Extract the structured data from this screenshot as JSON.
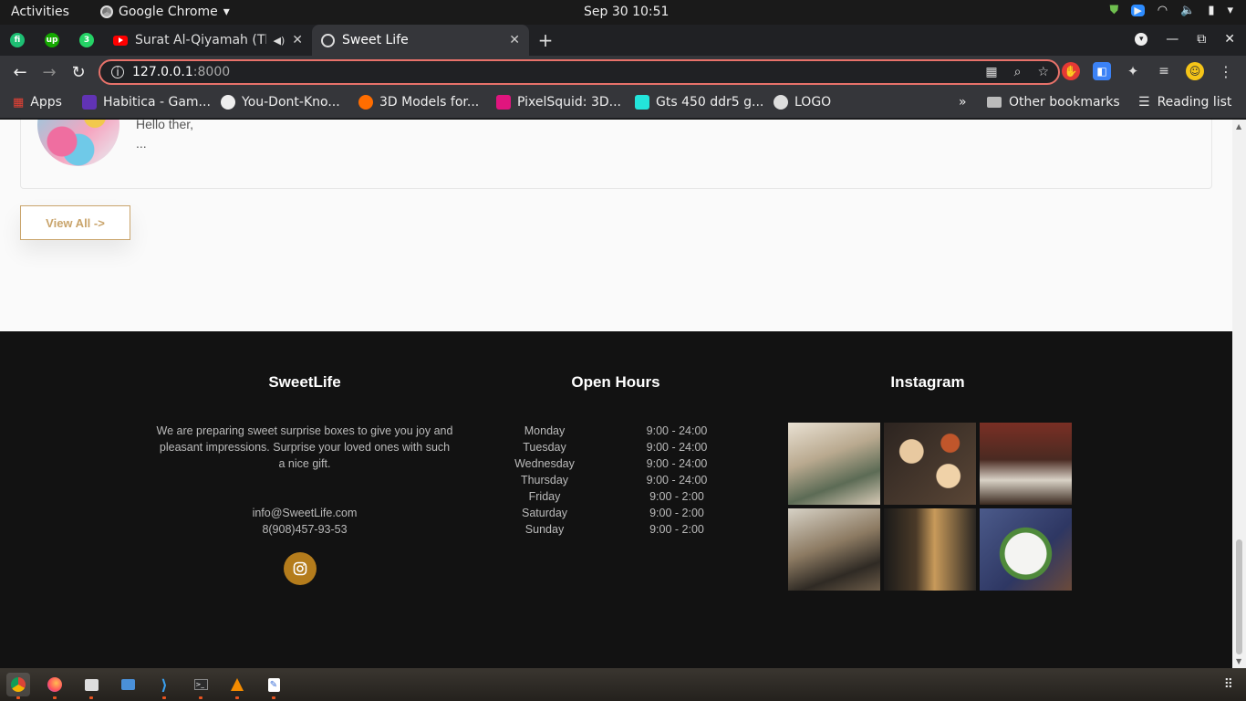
{
  "system": {
    "activities": "Activities",
    "app_name": "Google Chrome",
    "clock": "Sep 30  10:51"
  },
  "tabs": {
    "inactive_title": "Surat Al-Qiyamah (The",
    "active_title": "Sweet Life"
  },
  "toolbar": {
    "url_host": "127.0.0.1",
    "url_port": ":8000"
  },
  "bookmarks": [
    {
      "label": "Apps",
      "color": "#e94235"
    },
    {
      "label": "Habitica - Gam...",
      "color": "#6133b4"
    },
    {
      "label": "You-Dont-Kno...",
      "color": "#ffffff"
    },
    {
      "label": "3D Models for...",
      "color": "#ff6d00"
    },
    {
      "label": "PixelSquid: 3D...",
      "color": "#e0157e"
    },
    {
      "label": "Gts 450 ddr5 g...",
      "color": "#23e5db"
    },
    {
      "label": "LOGO",
      "color": "#dddddd"
    }
  ],
  "bookmarks_right": {
    "other": "Other bookmarks",
    "reading": "Reading list"
  },
  "review": {
    "line1": "Hello ther,",
    "line2": "..."
  },
  "view_all": "View All ->",
  "footer": {
    "about_title": "SweetLife",
    "about_text": "We are preparing sweet surprise boxes to give you joy and pleasant impressions. Surprise your loved ones with such a nice gift.",
    "email": "info@SweetLife.com",
    "phone": "8(908)457-93-53",
    "hours_title": "Open Hours",
    "hours": [
      {
        "day": "Monday",
        "time": "9:00 - 24:00"
      },
      {
        "day": "Tuesday",
        "time": "9:00 - 24:00"
      },
      {
        "day": "Wednesday",
        "time": "9:00 - 24:00"
      },
      {
        "day": "Thursday",
        "time": "9:00 - 24:00"
      },
      {
        "day": "Friday",
        "time": "9:00 - 2:00"
      },
      {
        "day": "Saturday",
        "time": "9:00 - 2:00"
      },
      {
        "day": "Sunday",
        "time": "9:00 - 2:00"
      }
    ],
    "instagram_title": "Instagram",
    "accent_color": "#b47c1c"
  },
  "icons": {
    "instagram": "instagram-icon",
    "back": "arrow-left-icon",
    "forward": "arrow-right-icon",
    "reload": "reload-icon"
  }
}
